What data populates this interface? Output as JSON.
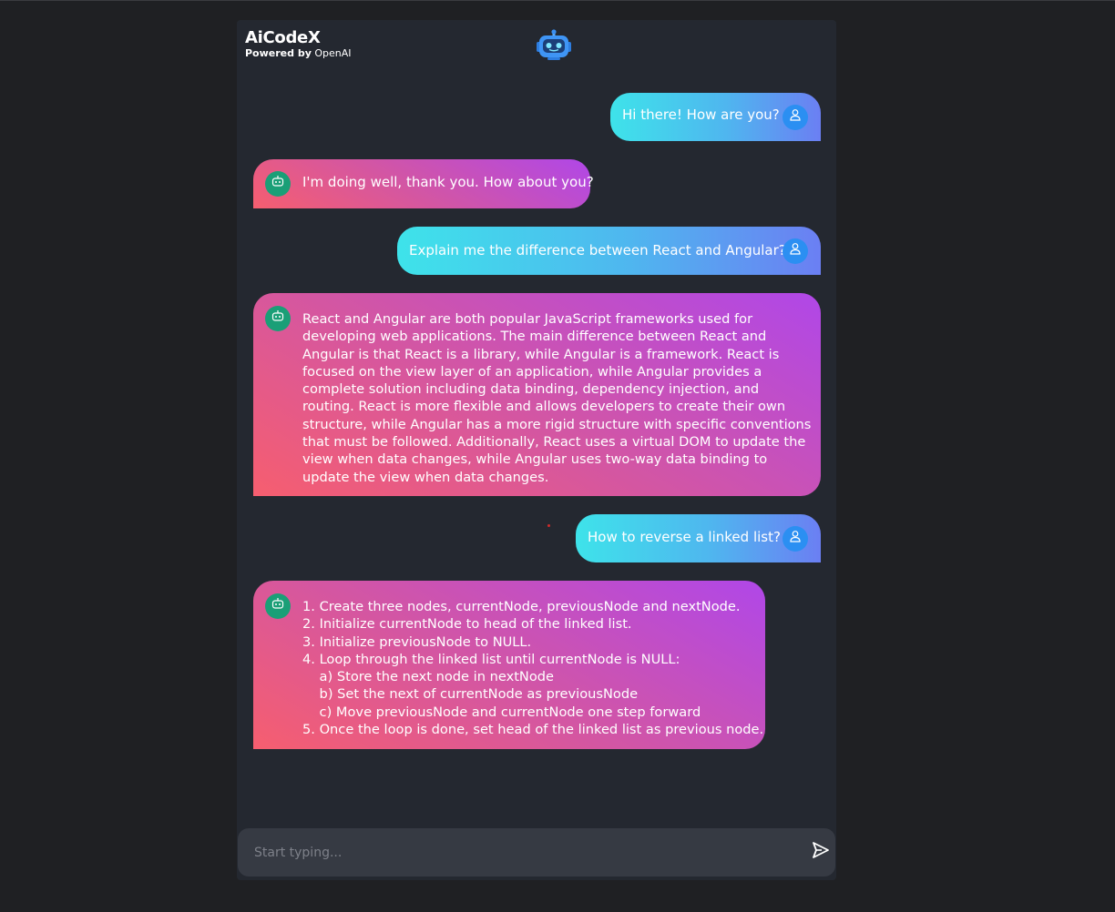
{
  "app": {
    "title": "AiCodeX",
    "powered_prefix": "Powered by",
    "powered_brand": "OpenAI"
  },
  "messages": [
    {
      "role": "user",
      "text": "Hi there! How are you?"
    },
    {
      "role": "bot",
      "text": "I'm doing well, thank you. How about you?"
    },
    {
      "role": "user",
      "text": "Explain me the difference between React and Angular?"
    },
    {
      "role": "bot",
      "text": "React and Angular are both popular JavaScript frameworks used for developing web applications. The main difference between React and Angular is that React is a library, while Angular is a framework. React is focused on the view layer of an application, while Angular provides a complete solution including data binding, dependency injection, and routing. React is more flexible and allows developers to create their own structure, while Angular has a more rigid structure with specific conventions that must be followed. Additionally, React uses a virtual DOM to update the view when data changes, while Angular uses two-way data binding to update the view when data changes."
    },
    {
      "role": "user",
      "text": "How to reverse a linked list?"
    },
    {
      "role": "bot",
      "text": "1. Create three nodes, currentNode, previousNode and nextNode.\n2. Initialize currentNode to head of the linked list.\n3. Initialize previousNode to NULL.\n4. Loop through the linked list until currentNode is NULL:\n    a) Store the next node in nextNode\n    b) Set the next of currentNode as previousNode\n    c) Move previousNode and currentNode one step forward\n5. Once the loop is done, set head of the linked list as previous node."
    }
  ],
  "input": {
    "placeholder": "Start typing...",
    "value": ""
  },
  "icons": {
    "logo": "robot-icon",
    "user_avatar": "user-icon",
    "bot_avatar": "bot-icon",
    "send": "send-icon"
  },
  "colors": {
    "background": "#1f2023",
    "panel": "#242830",
    "user_bubble_start": "#3ee3ea",
    "user_bubble_end": "#6b7ff3",
    "bot_bubble_start": "#f65e6f",
    "bot_bubble_end": "#b047e8",
    "user_avatar": "#2b8ff2",
    "bot_avatar": "#1a9f77"
  }
}
